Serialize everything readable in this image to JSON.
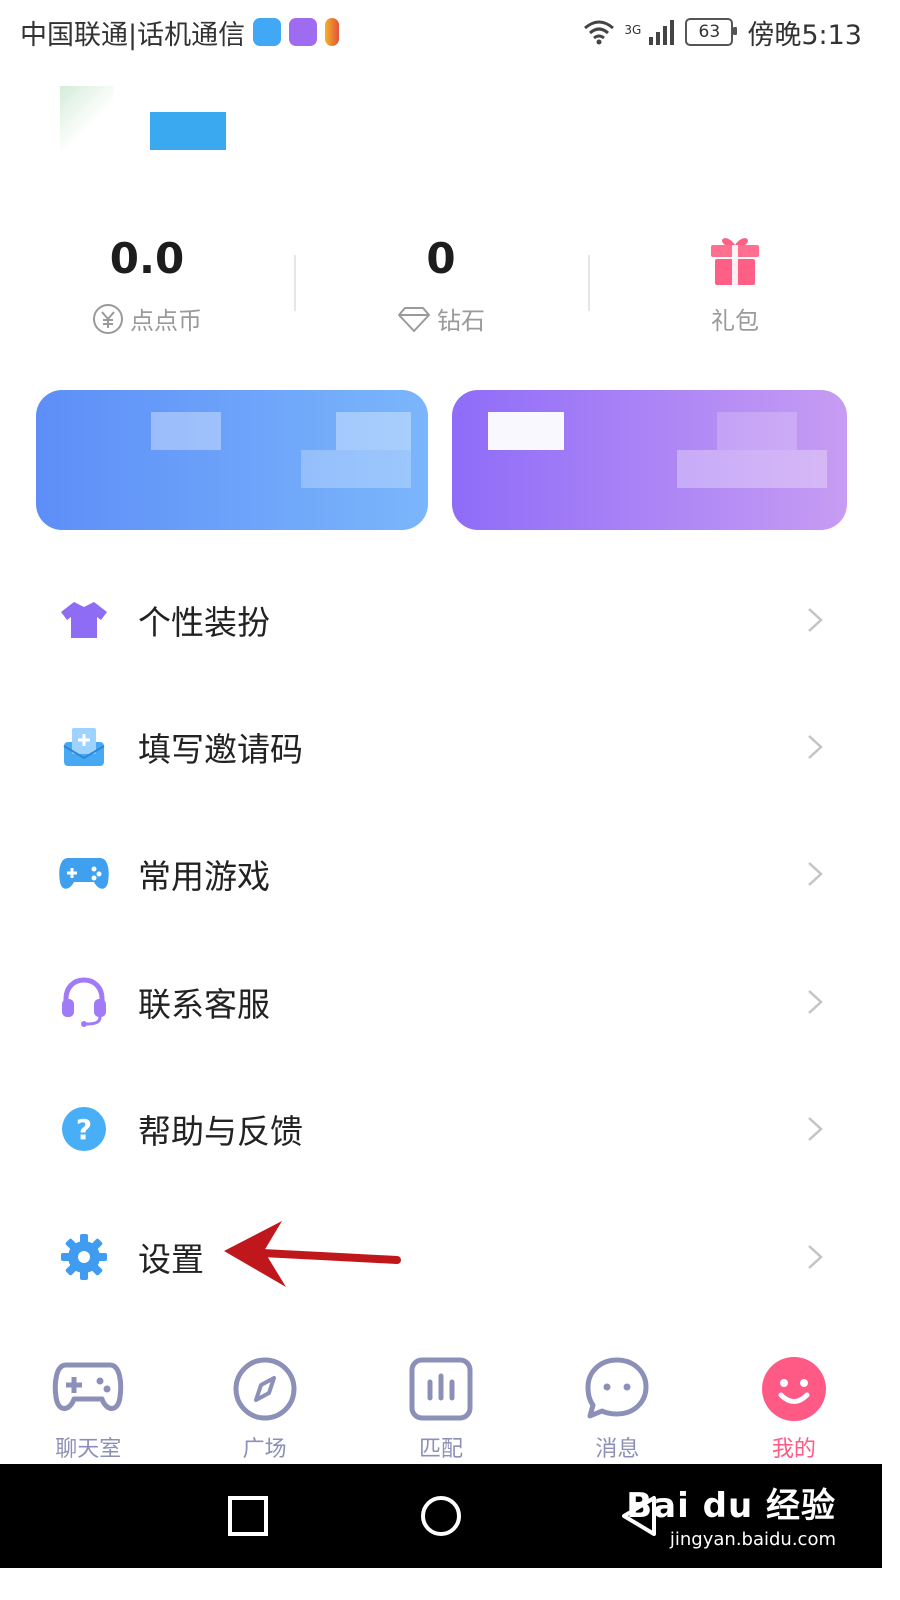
{
  "status_bar": {
    "carrier": "中国联通|话机通信",
    "network": "3G",
    "battery": "63",
    "time": "傍晚5:13"
  },
  "stats": [
    {
      "value": "0.0",
      "label": "点点币",
      "icon": "yen-coin-icon"
    },
    {
      "value": "0",
      "label": "钻石",
      "icon": "diamond-icon"
    },
    {
      "value": "",
      "label": "礼包",
      "icon": "gift-icon"
    }
  ],
  "menu": [
    {
      "label": "个性装扮",
      "icon": "shirt-icon",
      "color": "#8e6cf3"
    },
    {
      "label": "填写邀请码",
      "icon": "invite-mail-icon",
      "color": "#47a8f3"
    },
    {
      "label": "常用游戏",
      "icon": "gamepad-icon",
      "color": "#3fa0f0"
    },
    {
      "label": "联系客服",
      "icon": "headset-icon",
      "color": "#a17af5"
    },
    {
      "label": "帮助与反馈",
      "icon": "help-icon",
      "color": "#48aef5"
    },
    {
      "label": "设置",
      "icon": "gear-icon",
      "color": "#3f9cf0"
    }
  ],
  "bottom_nav": [
    {
      "label": "聊天室",
      "icon": "gamepad-nav-icon",
      "active": false
    },
    {
      "label": "广场",
      "icon": "compass-icon",
      "active": false
    },
    {
      "label": "匹配",
      "icon": "match-bars-icon",
      "active": false
    },
    {
      "label": "消息",
      "icon": "chat-bubble-icon",
      "active": false
    },
    {
      "label": "我的",
      "icon": "smile-icon",
      "active": true
    }
  ],
  "watermark": {
    "brand": "Bai du 经验",
    "url": "jingyan.baidu.com"
  },
  "colors": {
    "accent": "#ff5a86",
    "nav_inactive": "#8c90b8",
    "arrow": "#c0171c"
  }
}
